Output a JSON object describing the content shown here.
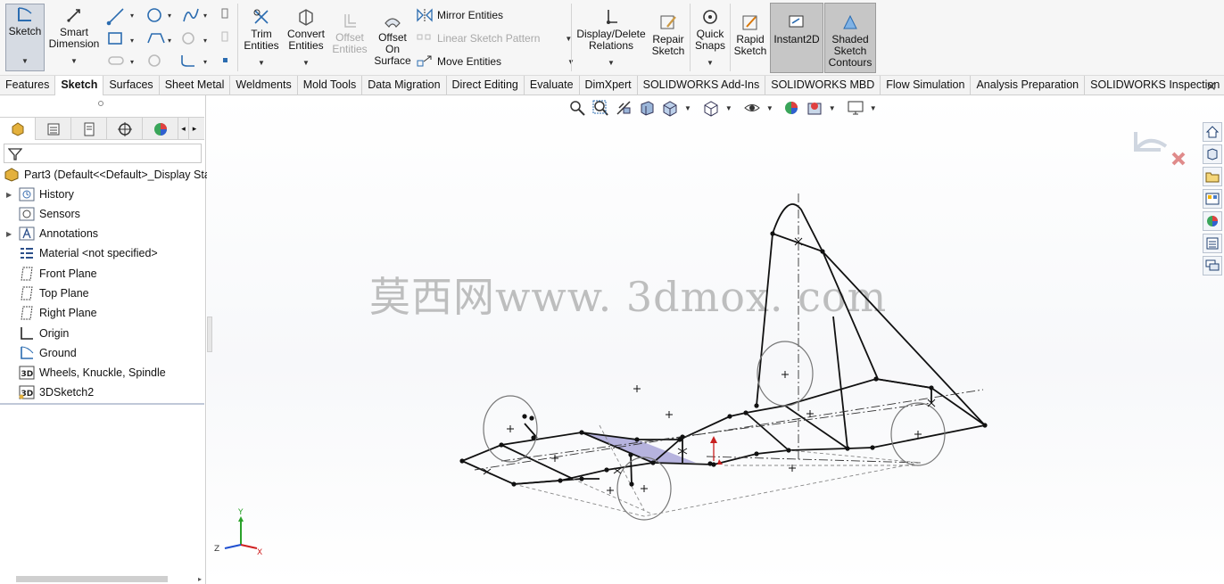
{
  "ribbon": {
    "sketch": "Sketch",
    "smart_dimension": [
      "Smart",
      "Dimension"
    ],
    "trim": [
      "Trim",
      "Entities"
    ],
    "convert": [
      "Convert",
      "Entities"
    ],
    "offset_entities": [
      "Offset",
      "Entities"
    ],
    "offset_surface": [
      "Offset",
      "On",
      "Surface"
    ],
    "mirror": "Mirror Entities",
    "linear_pattern": "Linear Sketch Pattern",
    "move": "Move Entities",
    "display_delete": [
      "Display/Delete",
      "Relations"
    ],
    "repair": [
      "Repair",
      "Sketch"
    ],
    "quick_snaps": [
      "Quick",
      "Snaps"
    ],
    "rapid_sketch": [
      "Rapid",
      "Sketch"
    ],
    "instant2d": "Instant2D",
    "shaded_contours": [
      "Shaded",
      "Sketch",
      "Contours"
    ]
  },
  "tabs": [
    "Features",
    "Sketch",
    "Surfaces",
    "Sheet Metal",
    "Weldments",
    "Mold Tools",
    "Data Migration",
    "Direct Editing",
    "Evaluate",
    "DimXpert",
    "SOLIDWORKS Add-Ins",
    "SOLIDWORKS MBD",
    "Flow Simulation",
    "Analysis Preparation",
    "SOLIDWORKS Inspection"
  ],
  "active_tab": "Sketch",
  "tree": {
    "root": "Part3  (Default<<Default>_Display Sta",
    "items": [
      "History",
      "Sensors",
      "Annotations",
      "Material <not specified>",
      "Front Plane",
      "Top Plane",
      "Right Plane",
      "Origin",
      "Ground",
      "Wheels, Knuckle, Spindle",
      "3DSketch2"
    ]
  },
  "watermark": "莫西网www. 3dmox. com",
  "triad": {
    "y": "Y",
    "z": "Z",
    "x": "X"
  },
  "colors": {
    "accent": "#2b6cb0",
    "selected_face": "#a9a6d8",
    "sketch": "#111111"
  }
}
